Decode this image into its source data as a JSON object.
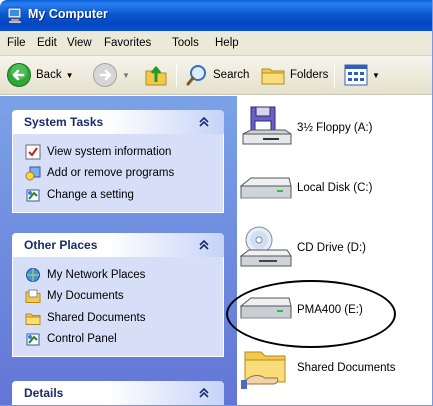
{
  "window": {
    "title": "My Computer",
    "colors": {
      "titlebar": "#0a58d0",
      "taskpane": "#6f8fdf",
      "panel_body": "#d6dff7"
    }
  },
  "menu": {
    "items": [
      "File",
      "Edit",
      "View",
      "Favorites",
      "Tools",
      "Help"
    ]
  },
  "toolbar": {
    "back_label": "Back",
    "search_label": "Search",
    "folders_label": "Folders"
  },
  "taskpane": {
    "system_tasks": {
      "title": "System Tasks",
      "items": [
        "View system information",
        "Add or remove programs",
        "Change a setting"
      ]
    },
    "other_places": {
      "title": "Other Places",
      "items": [
        "My Network Places",
        "My Documents",
        "Shared Documents",
        "Control Panel"
      ]
    },
    "details": {
      "title": "Details"
    }
  },
  "drives": [
    {
      "label": "3½ Floppy (A:)",
      "icon": "floppy-drive-icon"
    },
    {
      "label": "Local Disk (C:)",
      "icon": "hard-disk-icon"
    },
    {
      "label": "CD Drive (D:)",
      "icon": "cd-drive-icon"
    },
    {
      "label": "PMA400 (E:)",
      "icon": "removable-disk-icon"
    },
    {
      "label": "Shared Documents",
      "icon": "shared-folder-icon"
    }
  ]
}
